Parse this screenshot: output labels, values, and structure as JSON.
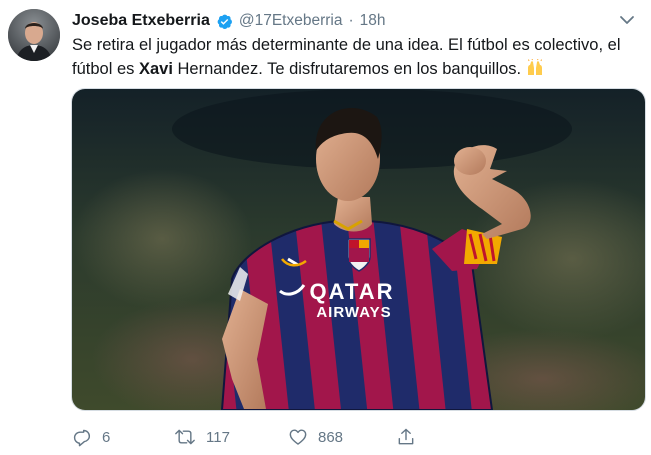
{
  "author": {
    "display_name": "Joseba Etxeberria",
    "handle": "@17Etxeberria",
    "separator": "·",
    "time": "18h"
  },
  "tweet": {
    "text_before_bold": "Se retira el jugador más determinante de una idea. El fútbol es colectivo, el fútbol es ",
    "bold": "Xavi",
    "text_after_bold": " Hernandez. Te disfrutaremos en los banquillos. ",
    "emoji": "raising-hands-emoji"
  },
  "media": {
    "jersey_sponsor_line1": "QATAR",
    "jersey_sponsor_line2": "AIRWAYS"
  },
  "actions": {
    "replies": "6",
    "retweets": "117",
    "likes": "868"
  },
  "colors": {
    "accent": "#1da1f2",
    "muted": "#657786",
    "text": "#14171a"
  }
}
